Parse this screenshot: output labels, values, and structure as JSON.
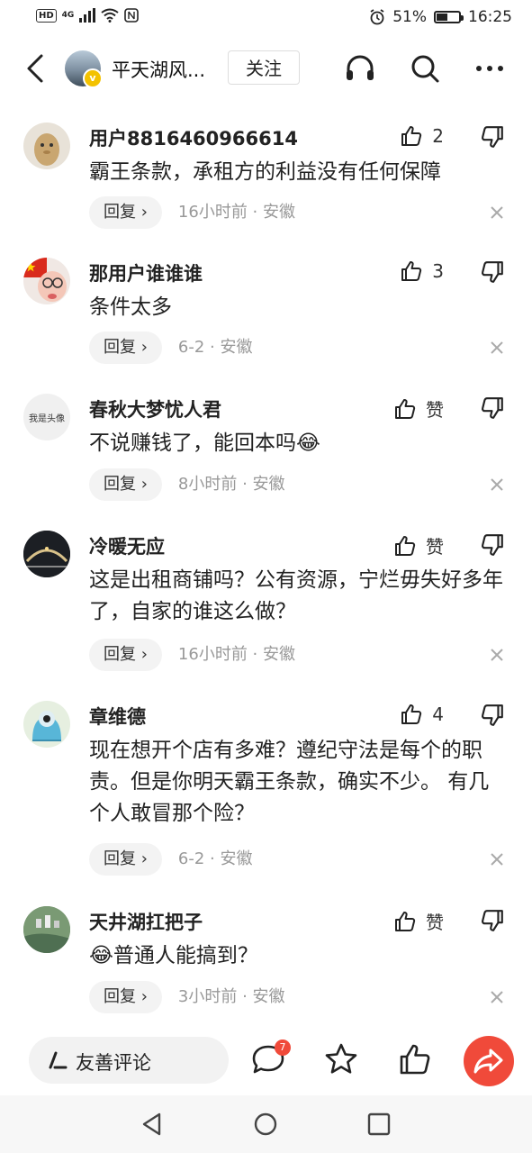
{
  "status_bar": {
    "network": "4G",
    "battery_percent": "51%",
    "time": "16:25"
  },
  "header": {
    "channel_name": "平天湖风...",
    "follow_label": "关注"
  },
  "comments": [
    {
      "username": "用户8816460966614",
      "likes": "2",
      "text": "霸王条款，承租方的利益没有任何保障",
      "reply_label": "回复 ›",
      "meta": "16小时前 · 安徽"
    },
    {
      "username": "那用户谁谁谁",
      "likes": "3",
      "text": "条件太多",
      "reply_label": "回复 ›",
      "meta": "6-2 · 安徽"
    },
    {
      "username": "春秋大梦忧人君",
      "likes": "赞",
      "text": "不说赚钱了，能回本吗",
      "emoji": "😂",
      "avatar_text": "我是头像",
      "reply_label": "回复 ›",
      "meta": "8小时前 · 安徽"
    },
    {
      "username": "冷暖无应",
      "likes": "赞",
      "text": "这是出租商铺吗？公有资源，宁烂毋失好多年了，自家的谁这么做？",
      "reply_label": "回复 ›",
      "meta": "16小时前 · 安徽"
    },
    {
      "username": "章维德",
      "likes": "4",
      "text": "现在想开个店有多难？遵纪守法是每个的职责。但是你明天霸王条款，确实不少。 有几个人敢冒那个险？",
      "reply_label": "回复 ›",
      "meta": "6-2 · 安徽"
    },
    {
      "username": "天井湖扛把子",
      "likes": "赞",
      "text": "普通人能搞到？",
      "emoji": "😂",
      "reply_label": "回复 ›",
      "meta": "3小时前 · 安徽"
    }
  ],
  "bottom_bar": {
    "comment_placeholder": "友善评论",
    "comment_badge": "7"
  },
  "icons": [
    "back-icon",
    "headphones-icon",
    "search-icon",
    "more-icon",
    "thumbs-up-icon",
    "thumbs-down-icon",
    "close-icon",
    "pen-icon",
    "comment-bubble-icon",
    "star-icon",
    "share-icon"
  ],
  "colors": {
    "accent": "#f04a3a",
    "verify": "#f3c200"
  }
}
